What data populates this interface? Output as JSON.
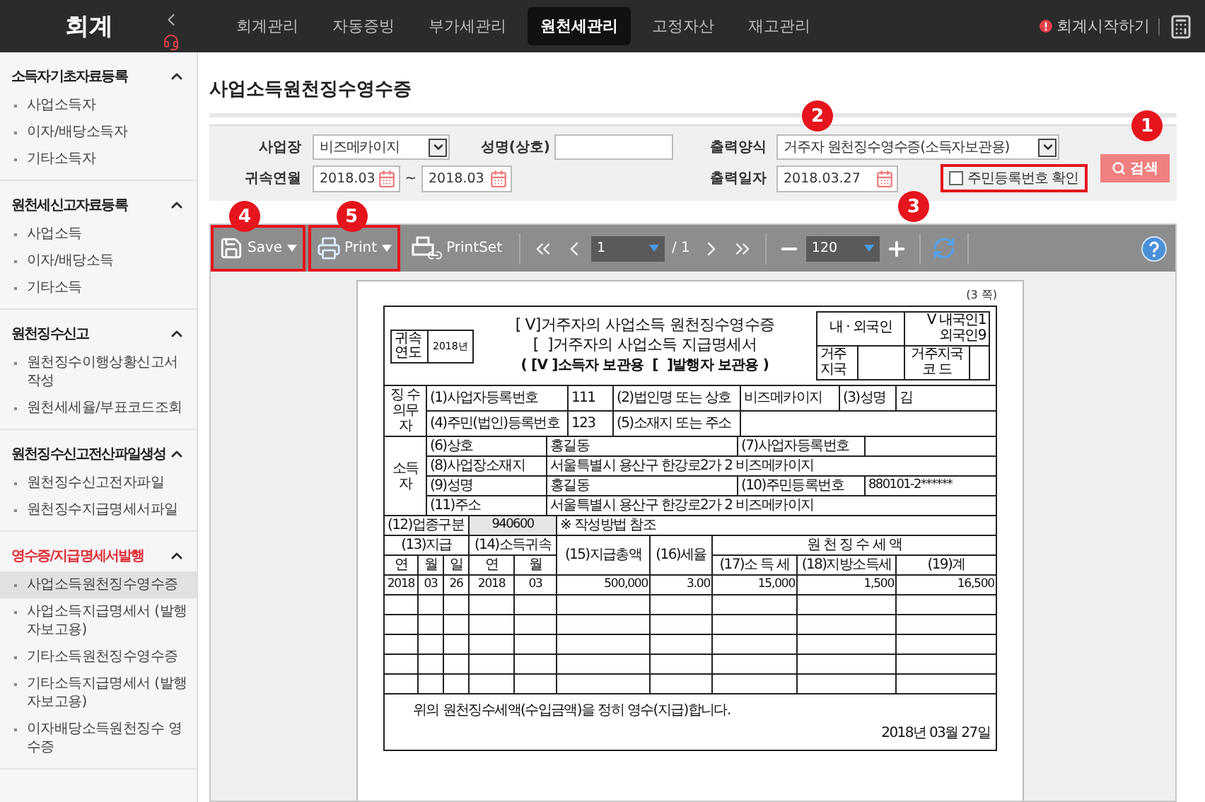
{
  "app": {
    "title": "회계"
  },
  "nav": [
    {
      "label": "회계관리",
      "selected": false
    },
    {
      "label": "자동증빙",
      "selected": false
    },
    {
      "label": "부가세관리",
      "selected": false
    },
    {
      "label": "원천세관리",
      "selected": true
    },
    {
      "label": "고정자산",
      "selected": false
    },
    {
      "label": "재고관리",
      "selected": false
    }
  ],
  "header_actions": {
    "start_link": "회계시작하기"
  },
  "sidebar": [
    {
      "title": "소득자기초자료등록",
      "active": false,
      "expanded": true,
      "items": [
        {
          "label": "사업소득자",
          "selected": false
        },
        {
          "label": "이자/배당소득자",
          "selected": false
        },
        {
          "label": "기타소득자",
          "selected": false
        }
      ]
    },
    {
      "title": "원천세신고자료등록",
      "active": false,
      "expanded": true,
      "items": [
        {
          "label": "사업소득",
          "selected": false
        },
        {
          "label": "이자/배당소득",
          "selected": false
        },
        {
          "label": "기타소득",
          "selected": false
        }
      ]
    },
    {
      "title": "원천징수신고",
      "active": false,
      "expanded": true,
      "items": [
        {
          "label": "원천징수이행상황신고서 작성",
          "selected": false
        },
        {
          "label": "원천세세율/부표코드조회",
          "selected": false
        }
      ]
    },
    {
      "title": "원천징수신고전산파일생성",
      "active": false,
      "expanded": true,
      "items": [
        {
          "label": "원천징수신고전자파일",
          "selected": false
        },
        {
          "label": "원천징수지급명세서파일",
          "selected": false
        }
      ]
    },
    {
      "title": "영수증/지급명세서발행",
      "active": true,
      "expanded": true,
      "items": [
        {
          "label": "사업소득원천징수영수증",
          "selected": true
        },
        {
          "label": "사업소득지급명세서 (발행자보고용)",
          "selected": false
        },
        {
          "label": "기타소득원천징수영수증",
          "selected": false
        },
        {
          "label": "기타소득지급명세서 (발행자보고용)",
          "selected": false
        },
        {
          "label": "이자배당소득원천징수 영수증",
          "selected": false
        }
      ]
    }
  ],
  "page_title": "사업소득원천징수영수증",
  "filters": {
    "workplace": {
      "label": "사업장",
      "value": "비즈메카이지"
    },
    "name": {
      "label": "성명(상호)"
    },
    "output_format": {
      "label": "출력양식",
      "value": "거주자 원천징수영수증(소득자보관용)",
      "badge": "2"
    },
    "period": {
      "label": "귀속연월",
      "from": "2018.03",
      "separator": "~",
      "to": "2018.03"
    },
    "output_date": {
      "label": "출력일자",
      "value": "2018.03.27"
    },
    "show_id": {
      "label": "주민등록번호 확인",
      "checked": false,
      "highlighted": true,
      "badge": "3"
    },
    "search_button": {
      "label": "검색",
      "badge": "1"
    }
  },
  "viewer": {
    "toolbar": {
      "save": {
        "label": "Save",
        "highlighted": true,
        "badge": "4"
      },
      "print": {
        "label": "Print",
        "highlighted": true,
        "badge": "5"
      },
      "print_set": {
        "label": "PrintSet"
      },
      "page": "1",
      "page_total": "/ 1",
      "zoom": "120"
    },
    "form": {
      "page_no": "(3 쪽)",
      "year_box": {
        "label": "귀속연도",
        "value": "2018년"
      },
      "titles": [
        "[ V]거주자의 사업소득 원천징수영수증",
        "[  ]거주자의 사업소득 지급명세서"
      ],
      "copy_line": "( [V ]소득자 보관용  [  ]발행자 보관용 )",
      "residency": {
        "nationality_label": "내 · 외국인",
        "nationality_value": "V 내국인1 외국인9",
        "country_label": "거주지국",
        "country_code_label": "거주지국 코 드"
      },
      "payer": {
        "group_label": "징 수 의무자",
        "fields": [
          {
            "label": "(1)사업자등록번호",
            "value": "111"
          },
          {
            "label": "(2)법인명 또는 상호",
            "value": "비즈메카이지"
          },
          {
            "label": "(3)성명",
            "value": "김"
          },
          {
            "label": "(4)주민(법인)등록번호",
            "value": "123"
          },
          {
            "label": "(5)소재지 또는 주소"
          }
        ]
      },
      "earner": {
        "group_label": "소득자",
        "rows": [
          [
            {
              "label": "(6)상호",
              "value": "홍길동"
            },
            {
              "label": "(7)사업자등록번호"
            }
          ],
          [
            {
              "label": "(8)사업장소재지",
              "value": "서울특별시 용산구 한강로2가 2 비즈메카이지"
            }
          ],
          [
            {
              "label": "(9)성명",
              "value": "홍길동"
            },
            {
              "label": "(10)주민등록번호",
              "value": "880101-2******"
            }
          ],
          [
            {
              "label": "(11)주소",
              "value": "서울특별시 용산구 한강로2가 2 비즈메카이지"
            }
          ]
        ]
      },
      "industry": {
        "label": "(12)업종구분",
        "code": "940600",
        "note": "※ 작성방법 참조"
      },
      "table": {
        "payment_group": "(13)지급",
        "period_group": "(14)소득귀속",
        "sub_columns": [
          "연",
          "월",
          "일",
          "연",
          "월"
        ],
        "total_column": "(15)지급총액",
        "rate_column": "(16)세율",
        "tax_group": "원 천 징 수 세 액",
        "tax_columns": [
          "(17)소 득 세",
          "(18)지방소득세",
          "(19)계"
        ],
        "rows": [
          [
            "2018",
            "03",
            "26",
            "2018",
            "03",
            "500,000",
            "3.00",
            "15,000",
            "1,500",
            "16,500"
          ]
        ]
      },
      "statement": "위의 원천징수세액(수입금액)을 정히 영수(지급)합니다.",
      "date": "2018년 03월 27일"
    }
  }
}
